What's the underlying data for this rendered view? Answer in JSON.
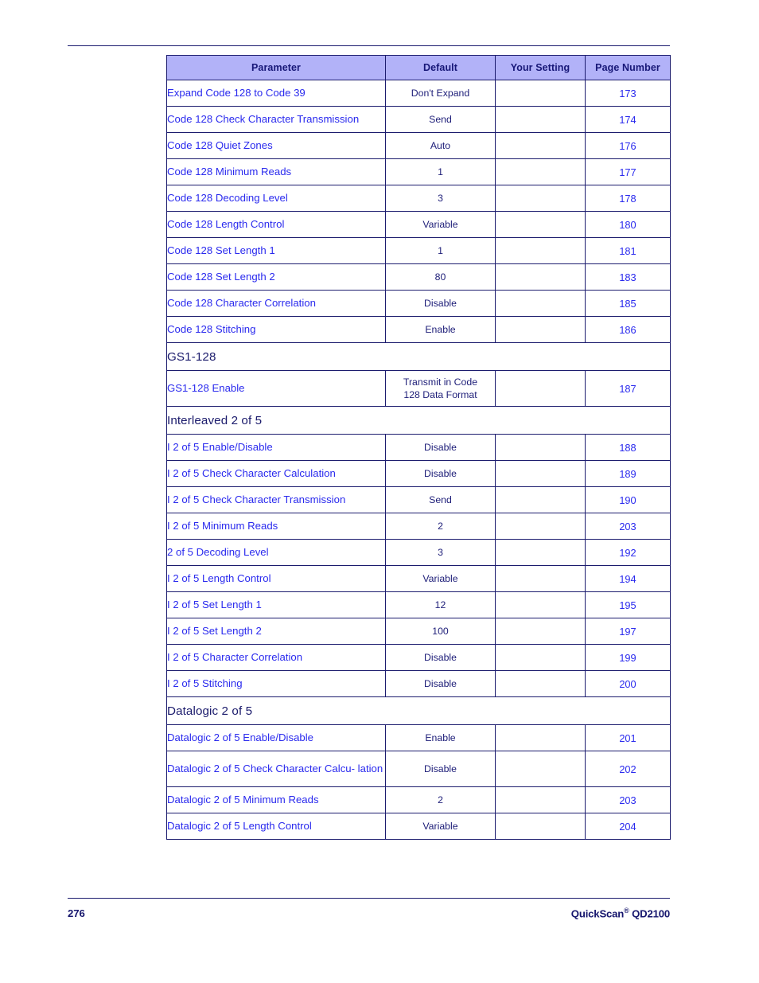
{
  "document": {
    "page_number": "276",
    "manual_name": "QuickScan",
    "manual_trademark": "®",
    "manual_model": "QD2100"
  },
  "colors": {
    "header_fill": "#b2b2f8",
    "header_text": "#181878",
    "link_blue": "#2a2aee",
    "navy": "#1d1d78",
    "rule": "#1b1b6e",
    "border": "#1c1c6e"
  },
  "table": {
    "columns": [
      {
        "label": "Parameter",
        "align": "left"
      },
      {
        "label": "Default",
        "align": "center"
      },
      {
        "label": "Your Setting",
        "align": "center"
      },
      {
        "label": "Page Number",
        "align": "center"
      }
    ],
    "rows": [
      {
        "kind": "data",
        "parameter": "Expand Code 128 to Code 39",
        "default": "Don't Expand",
        "your_setting": "",
        "page": "173"
      },
      {
        "kind": "data",
        "parameter": "Code 128 Check Character Transmission",
        "default": "Send",
        "your_setting": "",
        "page": "174"
      },
      {
        "kind": "data",
        "parameter": "Code 128 Quiet Zones",
        "default": "Auto",
        "your_setting": "",
        "page": "176"
      },
      {
        "kind": "data",
        "parameter": "Code 128 Minimum Reads",
        "default": "1",
        "your_setting": "",
        "page": "177"
      },
      {
        "kind": "data",
        "parameter": "Code 128 Decoding Level",
        "default": "3",
        "your_setting": "",
        "page": "178"
      },
      {
        "kind": "data",
        "parameter": "Code 128 Length Control",
        "default": "Variable",
        "your_setting": "",
        "page": "180"
      },
      {
        "kind": "data",
        "parameter": "Code 128 Set Length 1",
        "default": "1",
        "your_setting": "",
        "page": "181"
      },
      {
        "kind": "data",
        "parameter": "Code 128 Set Length 2",
        "default": "80",
        "your_setting": "",
        "page": "183"
      },
      {
        "kind": "data",
        "parameter": "Code 128 Character Correlation",
        "default": "Disable",
        "your_setting": "",
        "page": "185"
      },
      {
        "kind": "data",
        "parameter": "Code 128 Stitching",
        "default": "Enable",
        "your_setting": "",
        "page": "186"
      },
      {
        "kind": "section",
        "parameter": "GS1-128"
      },
      {
        "kind": "data",
        "parameter": "GS1-128 Enable",
        "default": "Transmit  in Code\n128 Data Format",
        "your_setting": "",
        "page": "187",
        "tall": true
      },
      {
        "kind": "section",
        "parameter": "Interleaved 2 of 5"
      },
      {
        "kind": "data",
        "parameter": "I 2 of 5 Enable/Disable",
        "default": "Disable",
        "your_setting": "",
        "page": "188"
      },
      {
        "kind": "data",
        "parameter": "I 2 of 5 Check Character Calculation",
        "default": "Disable",
        "your_setting": "",
        "page": "189"
      },
      {
        "kind": "data",
        "parameter": "I 2 of 5 Check Character Transmission",
        "default": "Send",
        "your_setting": "",
        "page": "190"
      },
      {
        "kind": "data",
        "parameter": "I 2 of 5 Minimum Reads",
        "default": "2",
        "your_setting": "",
        "page": "203"
      },
      {
        "kind": "data",
        "parameter": "2 of 5 Decoding Level",
        "default": "3",
        "your_setting": "",
        "page": "192"
      },
      {
        "kind": "data",
        "parameter": "I 2 of 5 Length Control",
        "default": "Variable",
        "your_setting": "",
        "page": "194"
      },
      {
        "kind": "data",
        "parameter": "I 2 of 5 Set Length 1",
        "default": "12",
        "your_setting": "",
        "page": "195"
      },
      {
        "kind": "data",
        "parameter": "I 2 of 5 Set Length 2",
        "default": "100",
        "your_setting": "",
        "page": "197"
      },
      {
        "kind": "data",
        "parameter": "I 2 of 5 Character Correlation",
        "default": "Disable",
        "your_setting": "",
        "page": "199"
      },
      {
        "kind": "data",
        "parameter": "I 2 of 5 Stitching",
        "default": "Disable",
        "your_setting": "",
        "page": "200"
      },
      {
        "kind": "section",
        "parameter": "Datalogic 2 of 5"
      },
      {
        "kind": "data",
        "parameter": "Datalogic 2 of 5 Enable/Disable",
        "default": "Enable",
        "your_setting": "",
        "page": "201"
      },
      {
        "kind": "data",
        "parameter": "Datalogic 2 of 5 Check Character Calcu-\nlation",
        "default": "Disable",
        "your_setting": "",
        "page": "202",
        "tall": true
      },
      {
        "kind": "data",
        "parameter": "Datalogic 2 of 5 Minimum Reads",
        "default": "2",
        "your_setting": "",
        "page": "203"
      },
      {
        "kind": "data",
        "parameter": "Datalogic 2 of 5 Length Control",
        "default": "Variable",
        "your_setting": "",
        "page": "204"
      }
    ]
  }
}
